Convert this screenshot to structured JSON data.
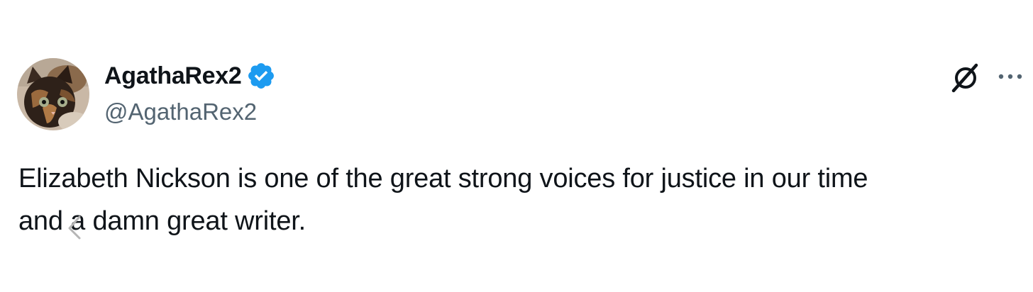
{
  "tweet": {
    "author": {
      "display_name": "AgathaRex2",
      "handle": "@AgathaRex2",
      "verified": true,
      "avatar_icon": "cat-avatar"
    },
    "text": "Elizabeth Nickson is one of the great strong voices for justice in our time\nand a damn great writer.",
    "actions": {
      "grok_icon": "grok-icon",
      "more_icon": "more-options-icon"
    }
  },
  "colors": {
    "text_primary": "#0f1419",
    "text_secondary": "#536471",
    "verified_blue": "#1d9bf0",
    "background": "#ffffff"
  }
}
